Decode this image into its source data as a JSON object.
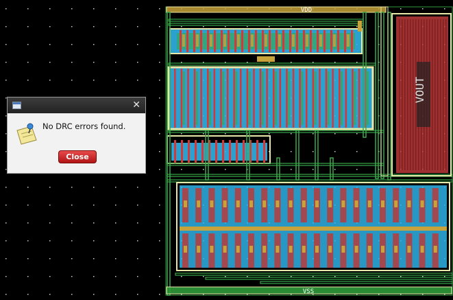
{
  "layout_view": {
    "labels": {
      "vdd": "VDD",
      "vss": "VSS",
      "vout": "VOUT"
    },
    "colors": {
      "background": "#000000",
      "metal1": "#2fb2e6",
      "metal2": "#c8a23a",
      "poly": "#d43838",
      "active": "#3aa84a",
      "nwell": "#e8e8a8",
      "output_block": "#b83a3a",
      "grid_dot": "#d0d0d0"
    }
  },
  "dialog": {
    "message": "No DRC errors found.",
    "close_label": "Close",
    "close_icon": "close-x-icon",
    "message_icon": "pushpin-note-icon"
  }
}
